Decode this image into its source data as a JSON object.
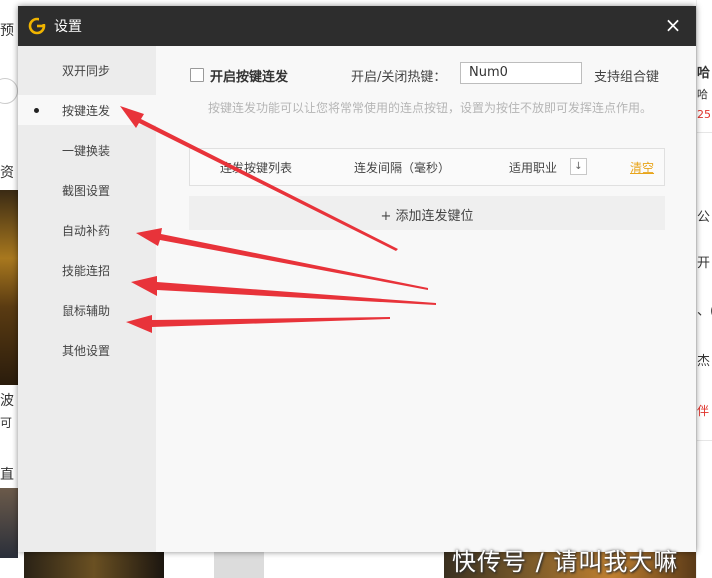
{
  "background": {
    "left_texts": [
      "预",
      "资",
      "波",
      "可",
      "直"
    ],
    "right_texts": [
      "哈",
      "哈",
      "25",
      "公",
      "开",
      "、(",
      "杰",
      "伴"
    ]
  },
  "watermark": "快传号 / 请叫我大嘛",
  "dialog": {
    "title": "设置",
    "close_symbol": "×",
    "sidebar": [
      {
        "label": "双开同步",
        "active": false
      },
      {
        "label": "按键连发",
        "active": true
      },
      {
        "label": "一键换装",
        "active": false
      },
      {
        "label": "截图设置",
        "active": false
      },
      {
        "label": "自动补药",
        "active": false
      },
      {
        "label": "技能连招",
        "active": false
      },
      {
        "label": "鼠标辅助",
        "active": false
      },
      {
        "label": "其他设置",
        "active": false
      }
    ],
    "main": {
      "enable_label": "开启按键连发",
      "hotkey_label": "开启/关闭热键：",
      "hotkey_value": "Num0",
      "combo_label": "支持组合键",
      "description": "按键连发功能可以让您将常常使用的连点按钮，设置为按住不放即可发挥连点作用。",
      "table": {
        "columns": [
          "连发按键列表",
          "连发间隔（毫秒）",
          "适用职业"
        ],
        "sort_symbol": "↓",
        "clear_label": "清空"
      },
      "add_button": "+ 添加连发键位"
    }
  },
  "colors": {
    "titlebar": "#2d2d2d",
    "accent_link": "#e8a41a",
    "arrow": "#e8333a",
    "logo": "#f0b400"
  }
}
